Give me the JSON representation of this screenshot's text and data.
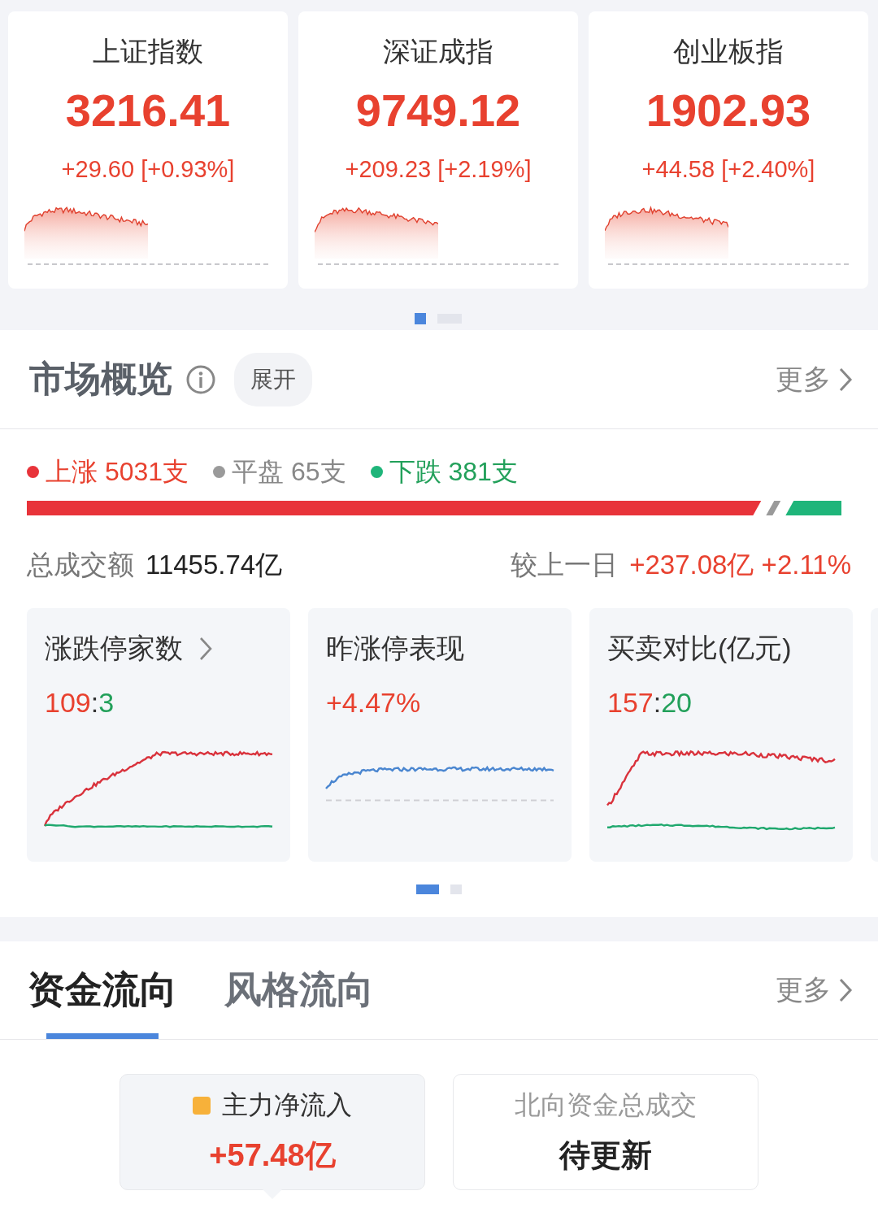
{
  "indices": [
    {
      "name": "上证指数",
      "value": "3216.41",
      "change": "+29.60 [+0.93%]"
    },
    {
      "name": "深证成指",
      "value": "9749.12",
      "change": "+209.23 [+2.19%]"
    },
    {
      "name": "创业板指",
      "value": "1902.93",
      "change": "+44.58 [+2.40%]"
    }
  ],
  "index_pager": [
    {
      "selected": true
    },
    {
      "selected": false
    }
  ],
  "market_overview": {
    "title": "市场概览",
    "expand_label": "展开",
    "more_label": "更多",
    "breadth": [
      {
        "label": "上涨 5031支",
        "color": "#e8333a"
      },
      {
        "label": "平盘 65支",
        "color": "#9a9a9a"
      },
      {
        "label": "下跌 381支",
        "color": "#1fb57a"
      }
    ],
    "turnover_label": "总成交额",
    "turnover_value": "11455.74亿",
    "compare_label": "较上一日",
    "compare_value": "+237.08亿 +2.11%"
  },
  "mini_cards": [
    {
      "title": "涨跌停家数",
      "link": true,
      "kind": "updown",
      "value_parts": [
        {
          "text": "109",
          "color": "#e8412f"
        },
        {
          "text": ":",
          "color": "#333333"
        },
        {
          "text": "3",
          "color": "#22a05a"
        }
      ]
    },
    {
      "title": "昨涨停表现",
      "link": false,
      "kind": "line",
      "value_parts": [
        {
          "text": "+4.47%",
          "color": "#e8412f"
        }
      ]
    },
    {
      "title": "买卖对比(亿元)",
      "link": false,
      "kind": "buysell",
      "value_parts": [
        {
          "text": "157",
          "color": "#e8412f"
        },
        {
          "text": ":",
          "color": "#333333"
        },
        {
          "text": "20",
          "color": "#22a05a"
        }
      ]
    }
  ],
  "card_pager": [
    {
      "selected": true
    },
    {
      "selected": false
    }
  ],
  "flow_tabs": [
    {
      "label": "资金流向",
      "selected": true
    },
    {
      "label": "风格流向",
      "selected": false
    }
  ],
  "flow_more_label": "更多",
  "flow_cards": [
    {
      "label": "主力净流入",
      "value": "+57.48亿",
      "kind": "amount",
      "color": "#f7b13a",
      "selected": true
    },
    {
      "label": "北向资金总成交",
      "value": "待更新",
      "kind": "pending",
      "selected": false
    }
  ]
}
